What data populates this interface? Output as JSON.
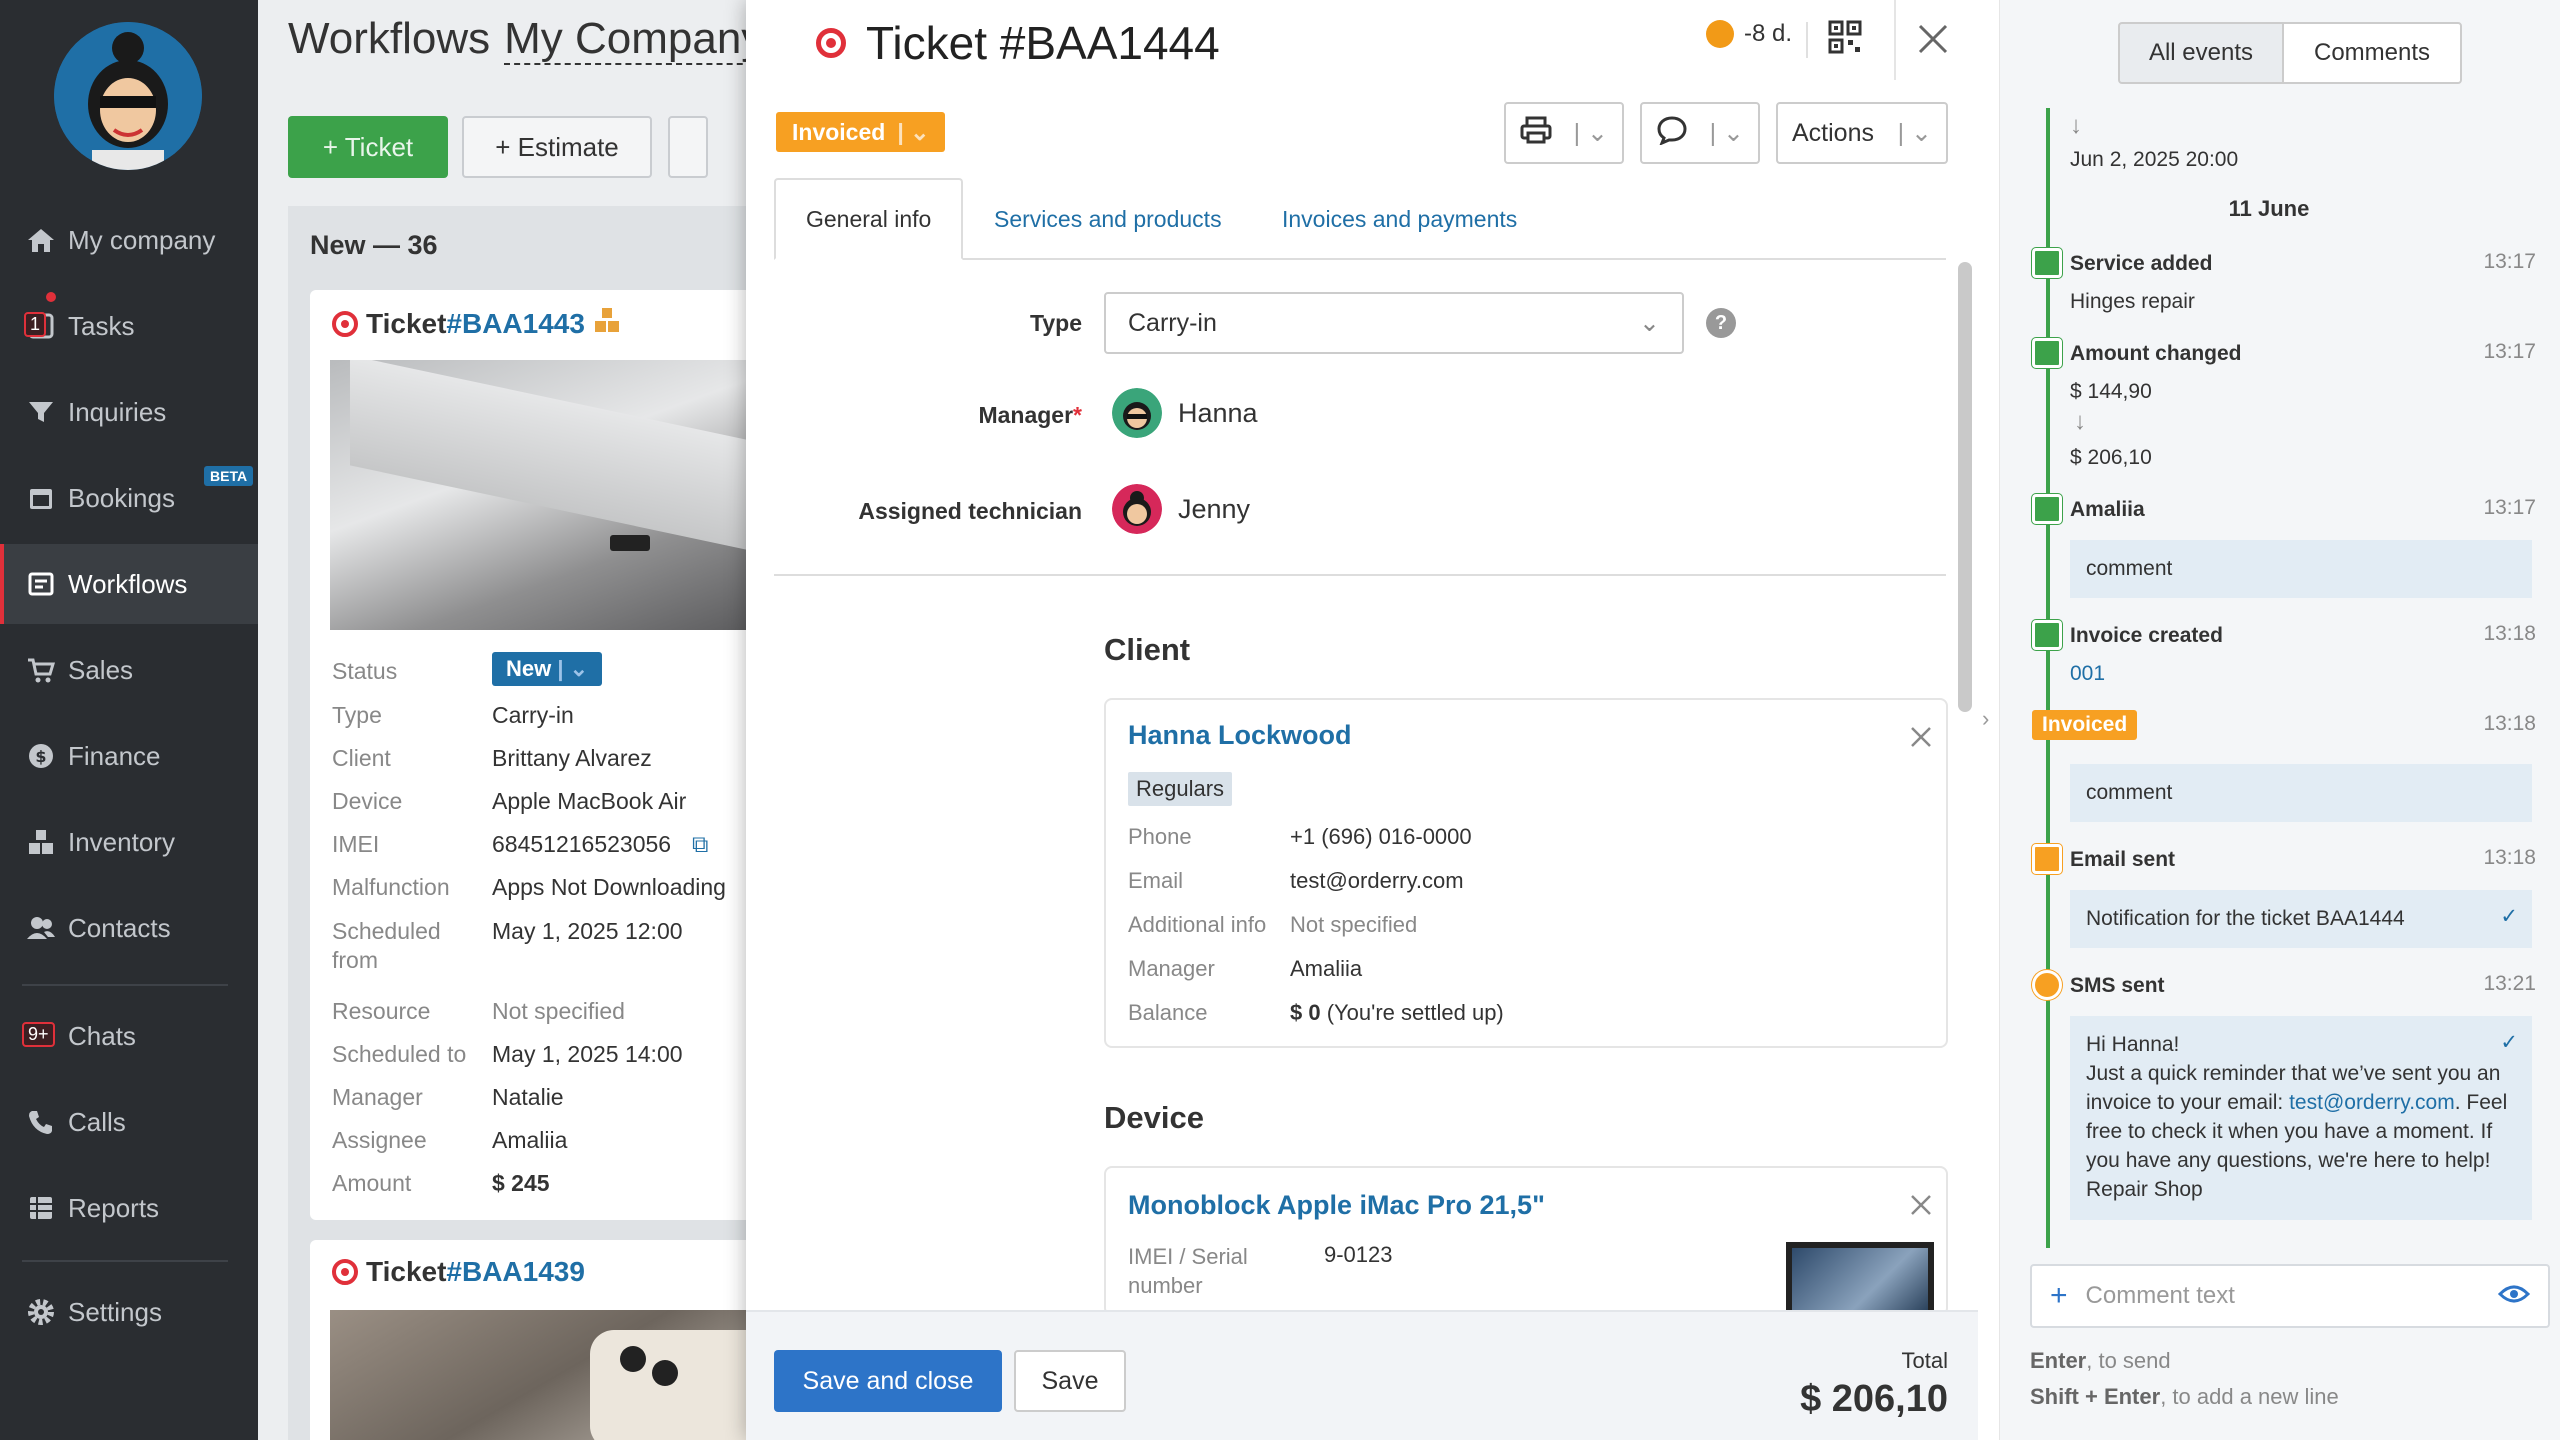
{
  "sidebar": {
    "items": [
      {
        "label": "My company"
      },
      {
        "label": "Tasks",
        "badge": "1"
      },
      {
        "label": "Inquiries"
      },
      {
        "label": "Bookings",
        "badge": "BETA"
      },
      {
        "label": "Workflows"
      },
      {
        "label": "Sales"
      },
      {
        "label": "Finance"
      },
      {
        "label": "Inventory"
      },
      {
        "label": "Contacts"
      },
      {
        "label": "Chats",
        "badge": "9+"
      },
      {
        "label": "Calls"
      },
      {
        "label": "Reports"
      },
      {
        "label": "Settings"
      }
    ]
  },
  "board": {
    "title": "Workflows",
    "company": "My Company",
    "add_ticket": "+ Ticket",
    "add_estimate": "+ Estimate",
    "column_title": "New — 36",
    "card1": {
      "prefix": "Ticket ",
      "number": "#BAA1443",
      "fields": [
        {
          "k": "Status",
          "v": "New"
        },
        {
          "k": "Type",
          "v": "Carry-in"
        },
        {
          "k": "Client",
          "v": "Brittany Alvarez"
        },
        {
          "k": "Device",
          "v": "Apple MacBook Air"
        },
        {
          "k": "IMEI",
          "v": "68451216523056"
        },
        {
          "k": "Malfunction",
          "v": "Apps Not Downloading"
        },
        {
          "k": "Scheduled from",
          "v": "May 1, 2025 12:00"
        },
        {
          "k": "Resource",
          "v": "Not specified"
        },
        {
          "k": "Scheduled to",
          "v": "May 1, 2025 14:00"
        },
        {
          "k": "Manager",
          "v": "Natalie"
        },
        {
          "k": "Assignee",
          "v": "Amaliia"
        },
        {
          "k": "Amount",
          "v": "$ 245"
        }
      ]
    },
    "card2": {
      "prefix": "Ticket ",
      "number": "#BAA1439"
    }
  },
  "ticket": {
    "title": "Ticket #BAA1444",
    "timer": "-8 d.",
    "status": "Invoiced",
    "actions_label": "Actions",
    "tabs": [
      "General info",
      "Services and products",
      "Invoices and payments"
    ],
    "type_label": "Type",
    "type_value": "Carry-in",
    "manager_label": "Manager",
    "manager_required": "*",
    "manager_value": "Hanna",
    "tech_label": "Assigned technician",
    "tech_value": "Jenny",
    "client_section": "Client",
    "client": {
      "name": "Hanna Lockwood",
      "tag": "Regulars",
      "fields": [
        {
          "k": "Phone",
          "v": "+1 (696) 016-0000"
        },
        {
          "k": "Email",
          "v": "test@orderry.com"
        },
        {
          "k": "Additional info",
          "v": "Not specified"
        },
        {
          "k": "Manager",
          "v": "Amaliia"
        }
      ],
      "balance_label": "Balance",
      "balance_amount": "$ 0",
      "balance_note": " (You're settled up)"
    },
    "device_section": "Device",
    "device": {
      "name": "Monoblock Apple iMac Pro 21,5\"",
      "imei_label": "IMEI / Serial number",
      "imei_value": "9-0123"
    },
    "save_close": "Save and close",
    "save": "Save",
    "total_label": "Total",
    "total_value": "$ 206,10"
  },
  "events": {
    "tabs": [
      "All events",
      "Comments"
    ],
    "first_date": "Jun 2, 2025 20:00",
    "day": "11 June",
    "items": [
      {
        "title": "Service added",
        "time": "13:17",
        "text": "Hinges repair"
      },
      {
        "title": "Amount changed",
        "time": "13:17",
        "from": "$ 144,90",
        "to": "$ 206,10"
      },
      {
        "title": "Amaliia",
        "time": "13:17",
        "comment": "comment"
      },
      {
        "title": "Invoice created",
        "time": "13:18",
        "link": "001"
      },
      {
        "badge": "Invoiced",
        "time": "13:18",
        "comment": "comment"
      },
      {
        "title": "Email sent",
        "time": "13:18",
        "comment": "Notification for the ticket BAA1444"
      },
      {
        "title": "SMS sent",
        "time": "13:21",
        "sms_pre": "Hi Hanna!\nJust a quick reminder that we’ve sent you an invoice to your email: ",
        "sms_link": "test@orderry.com",
        "sms_post": ". Feel free to check it when you have a moment. If you have any questions, we're here to help! Repair Shop"
      }
    ],
    "comment_placeholder": "Comment text",
    "hint1_b": "Enter",
    "hint1": ", to send",
    "hint2_b": "Shift + Enter",
    "hint2": ", to add a new line"
  },
  "colors": {
    "accent": "#2d74c8",
    "green": "#3ca24a",
    "orange": "#f7a022",
    "red": "#e0303a"
  }
}
